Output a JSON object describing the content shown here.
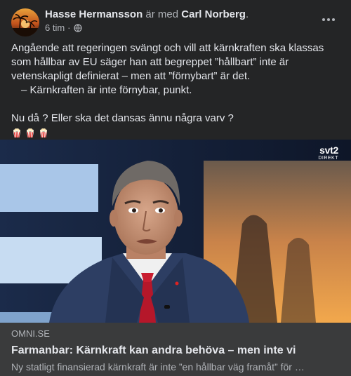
{
  "header": {
    "author_name": "Hasse Hermansson",
    "with_text": " är med ",
    "tagged_name": "Carl Norberg",
    "tagged_suffix": ".",
    "timestamp": "6 tim",
    "separator": "·",
    "privacy_icon": "globe-icon",
    "more_icon": "more-options-icon"
  },
  "post": {
    "paragraph_1": "Angående att regeringen svängt och vill att kärnkraften ska klassas som hållbar av EU säger han att begreppet ”hållbart” inte är vetenskapligt definierat – men att ”förnybart” är det.",
    "paragraph_2": "– Kärnkraften är inte förnybar, punkt.",
    "paragraph_3": "Nu då ? Eller ska det dansas ännu några varv ?",
    "emoji": [
      "popcorn-icon",
      "popcorn-icon",
      "popcorn-icon"
    ]
  },
  "media": {
    "logo_line_1": "svt2",
    "logo_line_2": "DIREKT"
  },
  "link": {
    "domain": "OMNI.SE",
    "title": "Farmanbar: Kärnkraft kan andra behöva – men inte vi",
    "description": "Ny statligt finansierad kärnkraft är inte ”en hållbar väg framåt” för …"
  },
  "colors": {
    "background": "#242526",
    "link_box": "#3a3b3c",
    "primary_text": "#e4e6eb",
    "secondary_text": "#b0b3b8"
  }
}
